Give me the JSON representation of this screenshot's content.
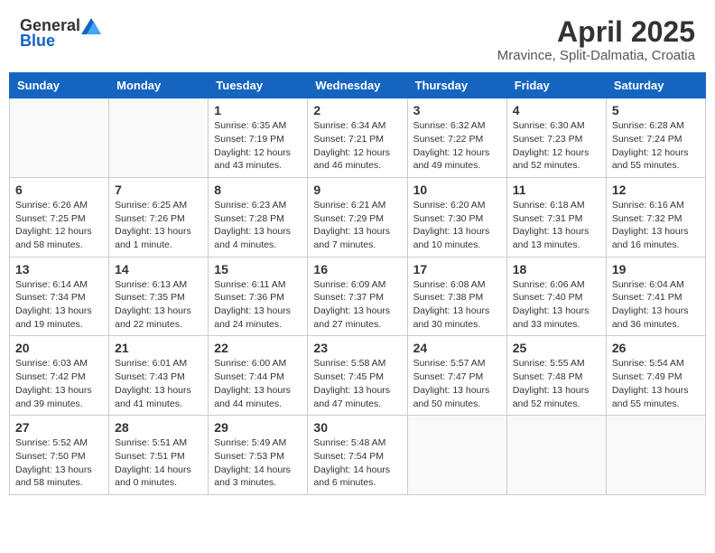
{
  "logo": {
    "text1": "General",
    "text2": "Blue"
  },
  "title": "April 2025",
  "location": "Mravince, Split-Dalmatia, Croatia",
  "headers": [
    "Sunday",
    "Monday",
    "Tuesday",
    "Wednesday",
    "Thursday",
    "Friday",
    "Saturday"
  ],
  "weeks": [
    [
      {
        "day": "",
        "info": ""
      },
      {
        "day": "",
        "info": ""
      },
      {
        "day": "1",
        "info": "Sunrise: 6:35 AM\nSunset: 7:19 PM\nDaylight: 12 hours and 43 minutes."
      },
      {
        "day": "2",
        "info": "Sunrise: 6:34 AM\nSunset: 7:21 PM\nDaylight: 12 hours and 46 minutes."
      },
      {
        "day": "3",
        "info": "Sunrise: 6:32 AM\nSunset: 7:22 PM\nDaylight: 12 hours and 49 minutes."
      },
      {
        "day": "4",
        "info": "Sunrise: 6:30 AM\nSunset: 7:23 PM\nDaylight: 12 hours and 52 minutes."
      },
      {
        "day": "5",
        "info": "Sunrise: 6:28 AM\nSunset: 7:24 PM\nDaylight: 12 hours and 55 minutes."
      }
    ],
    [
      {
        "day": "6",
        "info": "Sunrise: 6:26 AM\nSunset: 7:25 PM\nDaylight: 12 hours and 58 minutes."
      },
      {
        "day": "7",
        "info": "Sunrise: 6:25 AM\nSunset: 7:26 PM\nDaylight: 13 hours and 1 minute."
      },
      {
        "day": "8",
        "info": "Sunrise: 6:23 AM\nSunset: 7:28 PM\nDaylight: 13 hours and 4 minutes."
      },
      {
        "day": "9",
        "info": "Sunrise: 6:21 AM\nSunset: 7:29 PM\nDaylight: 13 hours and 7 minutes."
      },
      {
        "day": "10",
        "info": "Sunrise: 6:20 AM\nSunset: 7:30 PM\nDaylight: 13 hours and 10 minutes."
      },
      {
        "day": "11",
        "info": "Sunrise: 6:18 AM\nSunset: 7:31 PM\nDaylight: 13 hours and 13 minutes."
      },
      {
        "day": "12",
        "info": "Sunrise: 6:16 AM\nSunset: 7:32 PM\nDaylight: 13 hours and 16 minutes."
      }
    ],
    [
      {
        "day": "13",
        "info": "Sunrise: 6:14 AM\nSunset: 7:34 PM\nDaylight: 13 hours and 19 minutes."
      },
      {
        "day": "14",
        "info": "Sunrise: 6:13 AM\nSunset: 7:35 PM\nDaylight: 13 hours and 22 minutes."
      },
      {
        "day": "15",
        "info": "Sunrise: 6:11 AM\nSunset: 7:36 PM\nDaylight: 13 hours and 24 minutes."
      },
      {
        "day": "16",
        "info": "Sunrise: 6:09 AM\nSunset: 7:37 PM\nDaylight: 13 hours and 27 minutes."
      },
      {
        "day": "17",
        "info": "Sunrise: 6:08 AM\nSunset: 7:38 PM\nDaylight: 13 hours and 30 minutes."
      },
      {
        "day": "18",
        "info": "Sunrise: 6:06 AM\nSunset: 7:40 PM\nDaylight: 13 hours and 33 minutes."
      },
      {
        "day": "19",
        "info": "Sunrise: 6:04 AM\nSunset: 7:41 PM\nDaylight: 13 hours and 36 minutes."
      }
    ],
    [
      {
        "day": "20",
        "info": "Sunrise: 6:03 AM\nSunset: 7:42 PM\nDaylight: 13 hours and 39 minutes."
      },
      {
        "day": "21",
        "info": "Sunrise: 6:01 AM\nSunset: 7:43 PM\nDaylight: 13 hours and 41 minutes."
      },
      {
        "day": "22",
        "info": "Sunrise: 6:00 AM\nSunset: 7:44 PM\nDaylight: 13 hours and 44 minutes."
      },
      {
        "day": "23",
        "info": "Sunrise: 5:58 AM\nSunset: 7:45 PM\nDaylight: 13 hours and 47 minutes."
      },
      {
        "day": "24",
        "info": "Sunrise: 5:57 AM\nSunset: 7:47 PM\nDaylight: 13 hours and 50 minutes."
      },
      {
        "day": "25",
        "info": "Sunrise: 5:55 AM\nSunset: 7:48 PM\nDaylight: 13 hours and 52 minutes."
      },
      {
        "day": "26",
        "info": "Sunrise: 5:54 AM\nSunset: 7:49 PM\nDaylight: 13 hours and 55 minutes."
      }
    ],
    [
      {
        "day": "27",
        "info": "Sunrise: 5:52 AM\nSunset: 7:50 PM\nDaylight: 13 hours and 58 minutes."
      },
      {
        "day": "28",
        "info": "Sunrise: 5:51 AM\nSunset: 7:51 PM\nDaylight: 14 hours and 0 minutes."
      },
      {
        "day": "29",
        "info": "Sunrise: 5:49 AM\nSunset: 7:53 PM\nDaylight: 14 hours and 3 minutes."
      },
      {
        "day": "30",
        "info": "Sunrise: 5:48 AM\nSunset: 7:54 PM\nDaylight: 14 hours and 6 minutes."
      },
      {
        "day": "",
        "info": ""
      },
      {
        "day": "",
        "info": ""
      },
      {
        "day": "",
        "info": ""
      }
    ]
  ]
}
